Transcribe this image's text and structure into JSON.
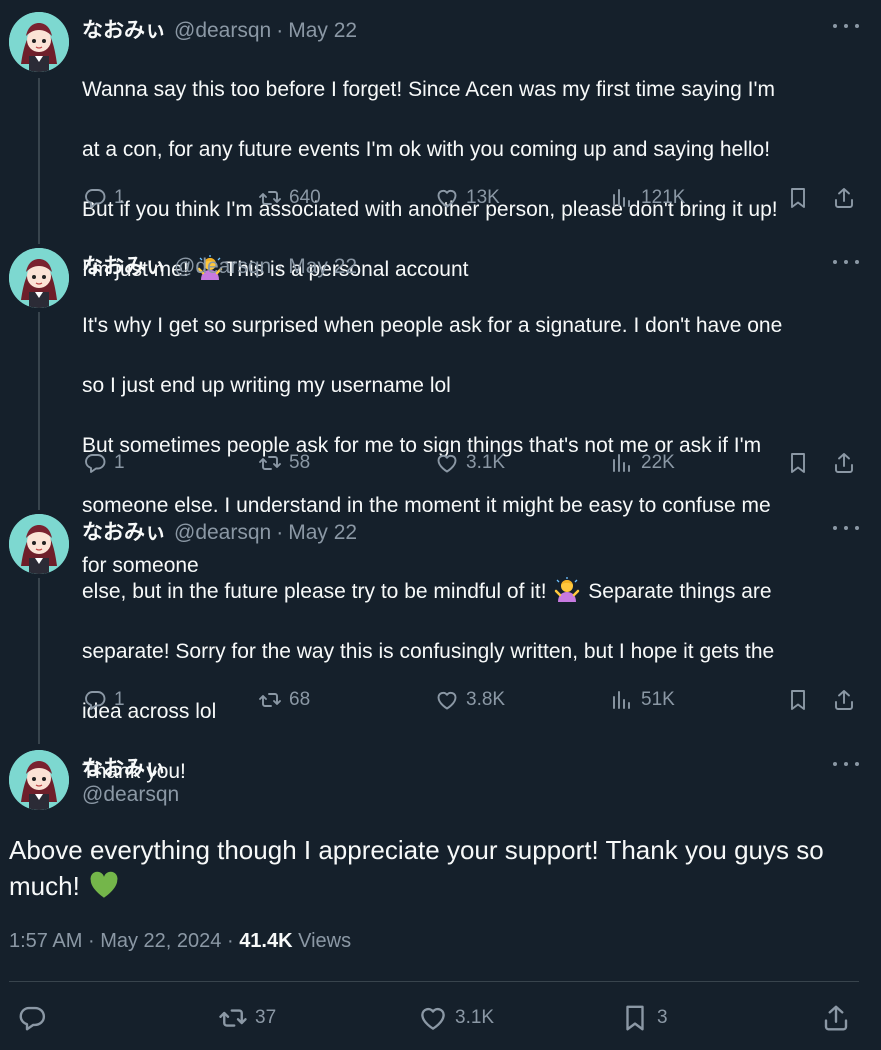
{
  "author": {
    "display_name": "なおみぃ",
    "handle": "@dearsqn",
    "separator": "·"
  },
  "thread": [
    {
      "date": "May 22",
      "lines": [
        "Wanna say this too before I forget! Since Acen was my first time saying I'm",
        "at a con, for any future events I'm ok with you coming up and saying hello!",
        "But if you think I'm associated with another person, please don't bring it up!",
        "I'm just me! "
      ],
      "tail_after_emoji": "This is a personal account",
      "stats": {
        "replies": "1",
        "reposts": "640",
        "likes": "13K",
        "views": "121K"
      }
    },
    {
      "date": "May 22",
      "lines": [
        "It's why I get so surprised when people ask for a signature. I don't have one",
        "so I just end up writing my username lol",
        "But sometimes people ask for me to sign things that's not me or ask if I'm",
        "someone else. I understand in the moment it might be easy to confuse me",
        "for someone"
      ],
      "stats": {
        "replies": "1",
        "reposts": "58",
        "likes": "3.1K",
        "views": "22K"
      }
    },
    {
      "date": "May 22",
      "line1_before_emoji": "else, but in the future please try to be mindful of it! ",
      "line1_after_emoji": " Separate things are",
      "lines": [
        "separate! Sorry for the way this is confusingly written, but I hope it gets the",
        "idea across lol",
        "Thank you!"
      ],
      "stats": {
        "replies": "1",
        "reposts": "68",
        "likes": "3.8K",
        "views": "51K"
      }
    }
  ],
  "main_tweet": {
    "text_line1": "Above everything though I appreciate your support! Thank you guys so",
    "text_line2": "much! ",
    "time": "1:57 AM",
    "date": "May 22, 2024",
    "views_count": "41.4K",
    "views_label": "Views",
    "stats": {
      "reposts": "37",
      "likes": "3.1K",
      "bookmarks": "3"
    }
  },
  "colors": {
    "background": "#15202b",
    "text": "#f7f9f9",
    "muted": "#8b98a5",
    "divider": "#38444d",
    "avatar_bg": "#7dd8d0"
  },
  "icons": [
    "reply-icon",
    "repost-icon",
    "like-icon",
    "views-icon",
    "bookmark-icon",
    "share-icon",
    "more-icon",
    "green-heart-emoji",
    "person-emoji"
  ]
}
